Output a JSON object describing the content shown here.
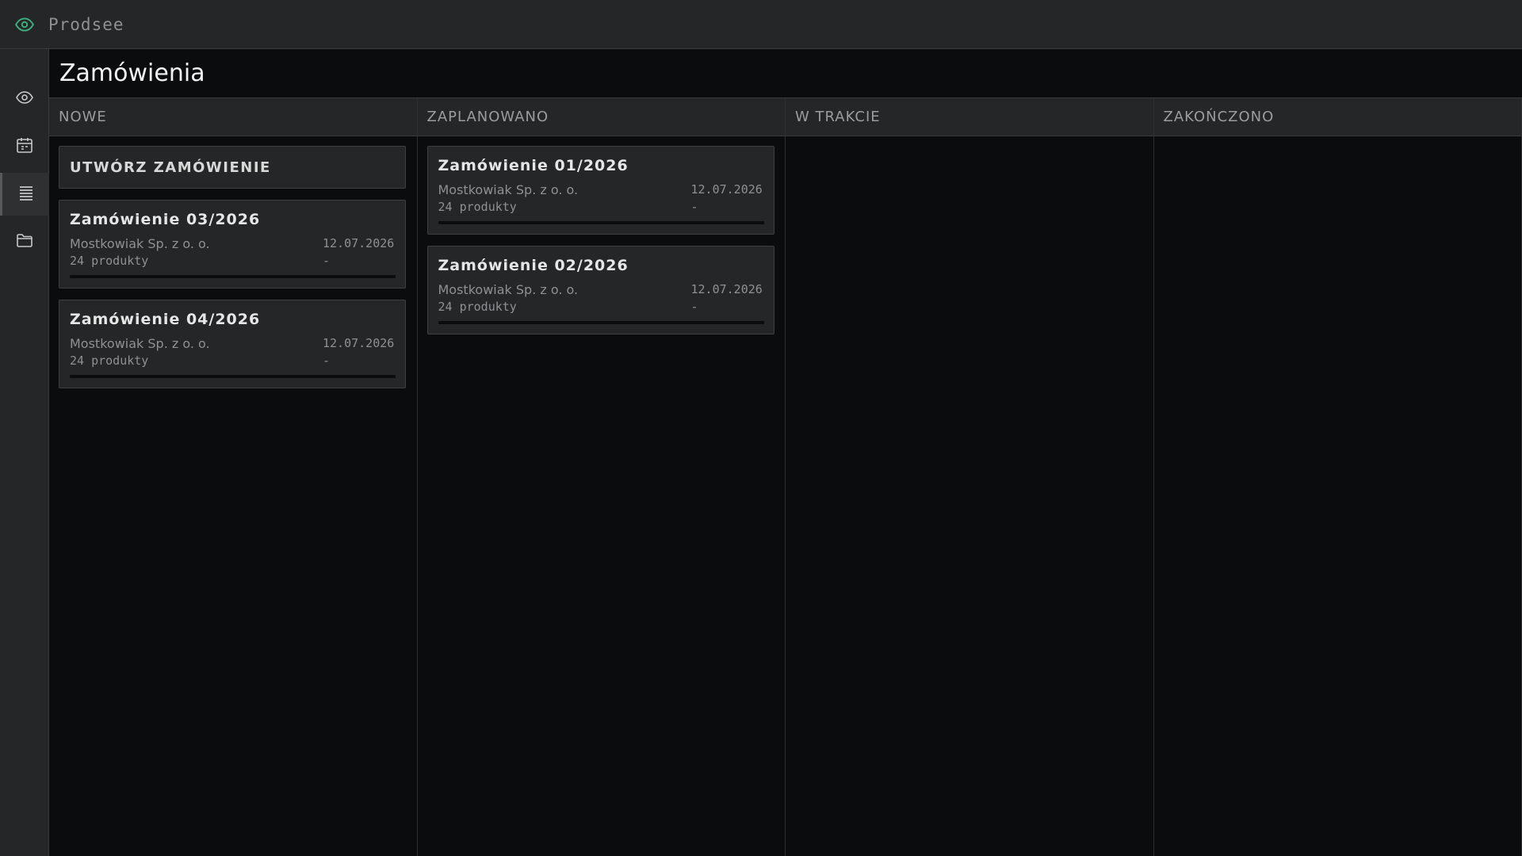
{
  "app": {
    "name": "Prodsee",
    "logo_icon": "eye-icon",
    "accent": "#3fae7f"
  },
  "sidebar": {
    "items": [
      {
        "name": "eye-icon",
        "active": false
      },
      {
        "name": "calendar-icon",
        "active": false
      },
      {
        "name": "list-icon",
        "active": true
      },
      {
        "name": "folder-icon",
        "active": false
      }
    ]
  },
  "page": {
    "title": "Zamówienia"
  },
  "columns": [
    {
      "title": "NOWE"
    },
    {
      "title": "ZAPLANOWANO"
    },
    {
      "title": "W TRAKCIE"
    },
    {
      "title": "ZAKOŃCZONO"
    }
  ],
  "create_button": {
    "label": "UTWÓRZ ZAMÓWIENIE"
  },
  "cards": {
    "nowe": [
      {
        "title": "Zamówienie 03/2026",
        "client": "Mostkowiak Sp. z o. o.",
        "date": "12.07.2026",
        "products": "24 produkty",
        "status": "-",
        "progress": 0
      },
      {
        "title": "Zamówienie 04/2026",
        "client": "Mostkowiak Sp. z o. o.",
        "date": "12.07.2026",
        "products": "24 produkty",
        "status": "-",
        "progress": 0
      }
    ],
    "zaplanowano": [
      {
        "title": "Zamówienie 01/2026",
        "client": "Mostkowiak Sp. z o. o.",
        "date": "12.07.2026",
        "products": "24 produkty",
        "status": "-",
        "progress": 0
      },
      {
        "title": "Zamówienie 02/2026",
        "client": "Mostkowiak Sp. z o. o.",
        "date": "12.07.2026",
        "products": "24 produkty",
        "status": "-",
        "progress": 0
      }
    ]
  }
}
